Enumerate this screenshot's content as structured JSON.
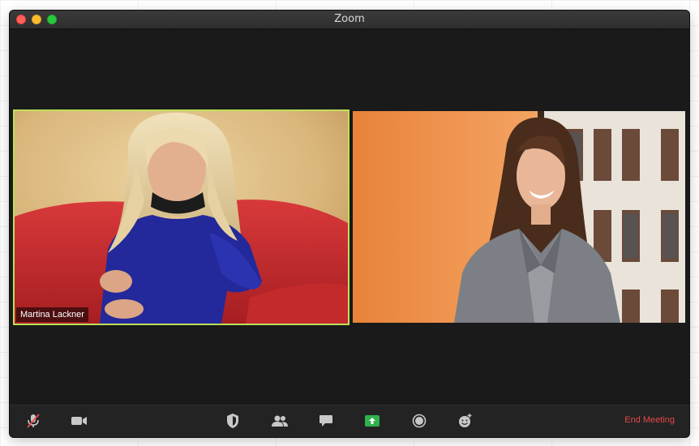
{
  "window": {
    "title": "Zoom"
  },
  "participants": [
    {
      "name": "Martina Lackner",
      "active_speaker": true
    },
    {
      "name": "",
      "active_speaker": false
    }
  ],
  "toolbar": {
    "icons": [
      "mute-microphone-icon",
      "video-camera-icon",
      "security-shield-icon",
      "participants-icon",
      "chat-icon",
      "share-screen-icon",
      "record-icon",
      "reactions-icon"
    ],
    "end_meeting_label": "End Meeting"
  },
  "colors": {
    "active_speaker_border": "#bde05b",
    "share_screen_green": "#2fb24c",
    "end_meeting_red": "#e5484d"
  }
}
